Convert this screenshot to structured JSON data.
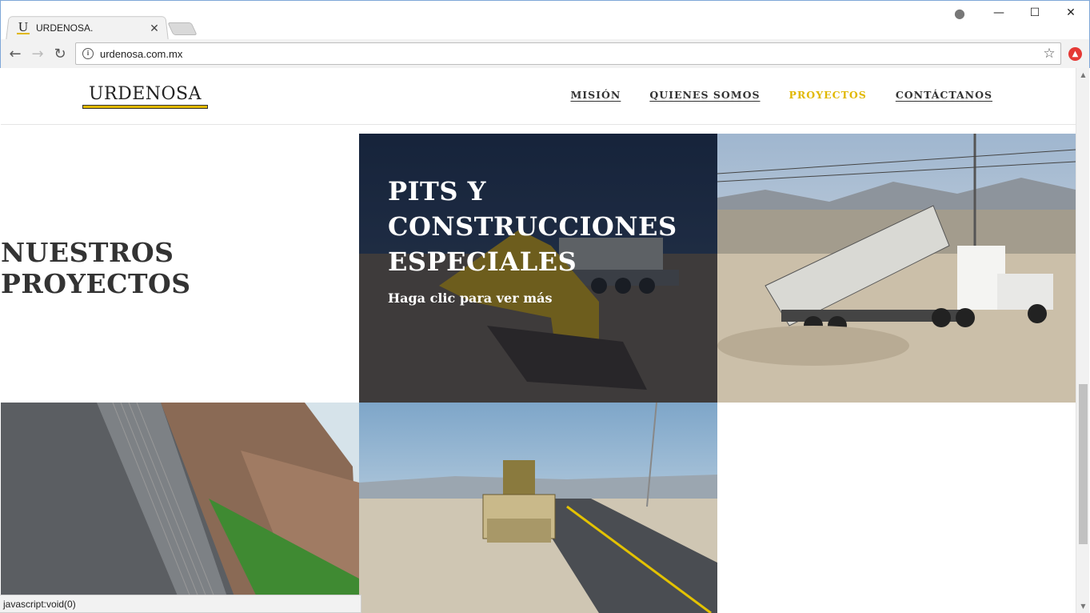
{
  "browser": {
    "tab_title": "URDENOSA.",
    "favicon_letter": "U",
    "tab_close": "✕",
    "url": "urdenosa.com.mx",
    "back": "←",
    "forward": "→",
    "reload": "↻",
    "star": "☆",
    "info": "i",
    "profile": "●",
    "minimize": "—",
    "maximize": "☐",
    "close": "✕",
    "status_text": "javascript:void(0)"
  },
  "site": {
    "logo": "URDENOSA",
    "nav": [
      {
        "label": "MISIÓN"
      },
      {
        "label": "QUIENES SOMOS"
      },
      {
        "label": "PROYECTOS"
      },
      {
        "label": "CONTÁCTANOS"
      }
    ],
    "section_title": "NUESTROS PROYECTOS",
    "tiles": [
      {
        "title": "PITS Y CONSTRUCCIONES ESPECIALES",
        "cta": "Haga clic para ver más"
      }
    ]
  },
  "colors": {
    "accent": "#e1b800",
    "text": "#333333"
  }
}
